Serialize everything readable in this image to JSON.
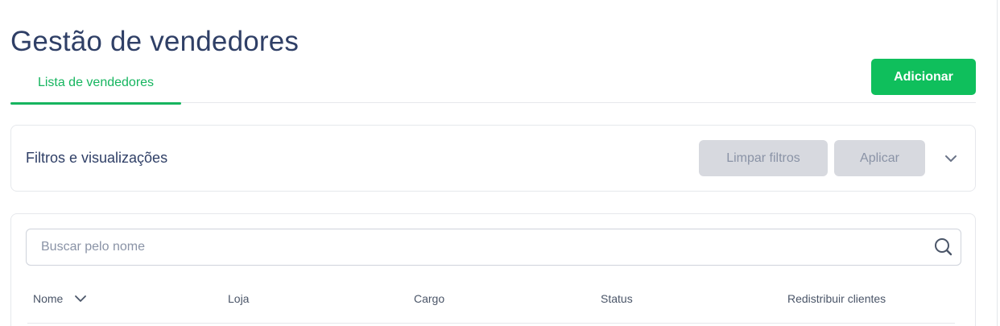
{
  "page": {
    "title": "Gestão de vendedores"
  },
  "tabs": [
    {
      "label": "Lista de vendedores",
      "active": true
    }
  ],
  "actions": {
    "add_label": "Adicionar"
  },
  "filters": {
    "title": "Filtros e visualizações",
    "clear_label": "Limpar filtros",
    "apply_label": "Aplicar",
    "toggle_icon": "chevron-down-icon"
  },
  "search": {
    "placeholder": "Buscar pelo nome",
    "value": "",
    "icon": "search-icon"
  },
  "table": {
    "columns": [
      {
        "label": "Nome",
        "sortable": true
      },
      {
        "label": "Loja"
      },
      {
        "label": "Cargo"
      },
      {
        "label": "Status"
      },
      {
        "label": "Redistribuir clientes"
      }
    ]
  },
  "colors": {
    "accent": "#0fbf5c",
    "title": "#2f3f66",
    "disabled_button": "#d7d9df"
  }
}
